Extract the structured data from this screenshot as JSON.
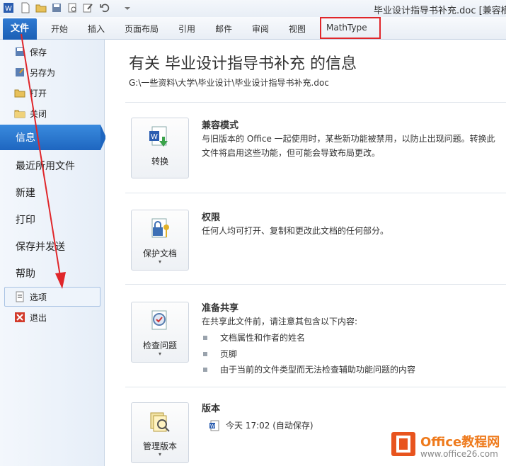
{
  "window": {
    "title": "毕业设计指导书补充.doc [兼容模式"
  },
  "ribbon": {
    "tabs": [
      "文件",
      "开始",
      "插入",
      "页面布局",
      "引用",
      "邮件",
      "审阅",
      "视图",
      "MathType"
    ]
  },
  "sidebar": {
    "small_items": [
      "保存",
      "另存为",
      "打开",
      "关闭"
    ],
    "big_items": [
      "信息",
      "最近所用文件",
      "新建",
      "打印",
      "保存并发送",
      "帮助"
    ],
    "bottom_items": [
      "选项",
      "退出"
    ]
  },
  "main": {
    "title": "有关 毕业设计指导书补充 的信息",
    "path": "G:\\一些资料\\大学\\毕业设计\\毕业设计指导书补充.doc",
    "sections": [
      {
        "button": "转换",
        "title": "兼容模式",
        "desc": "与旧版本的 Office 一起使用时，某些新功能被禁用，以防止出现问题。转换此文件将启用这些功能，但可能会导致布局更改。"
      },
      {
        "button": "保护文档",
        "title": "权限",
        "desc": "任何人均可打开、复制和更改此文档的任何部分。"
      },
      {
        "button": "检查问题",
        "title": "准备共享",
        "desc": "在共享此文件前，请注意其包含以下内容:",
        "bullets": [
          "文档属性和作者的姓名",
          "页脚",
          "由于当前的文件类型而无法检查辅助功能问题的内容"
        ]
      },
      {
        "button": "管理版本",
        "title": "版本",
        "version": "今天 17:02 (自动保存)"
      }
    ]
  },
  "watermark": {
    "line1": "Office教程网",
    "line2": "www.office26.com"
  },
  "colors": {
    "accent": "#1e66c0",
    "highlight": "#e0262a",
    "logo": "#e8541e"
  }
}
